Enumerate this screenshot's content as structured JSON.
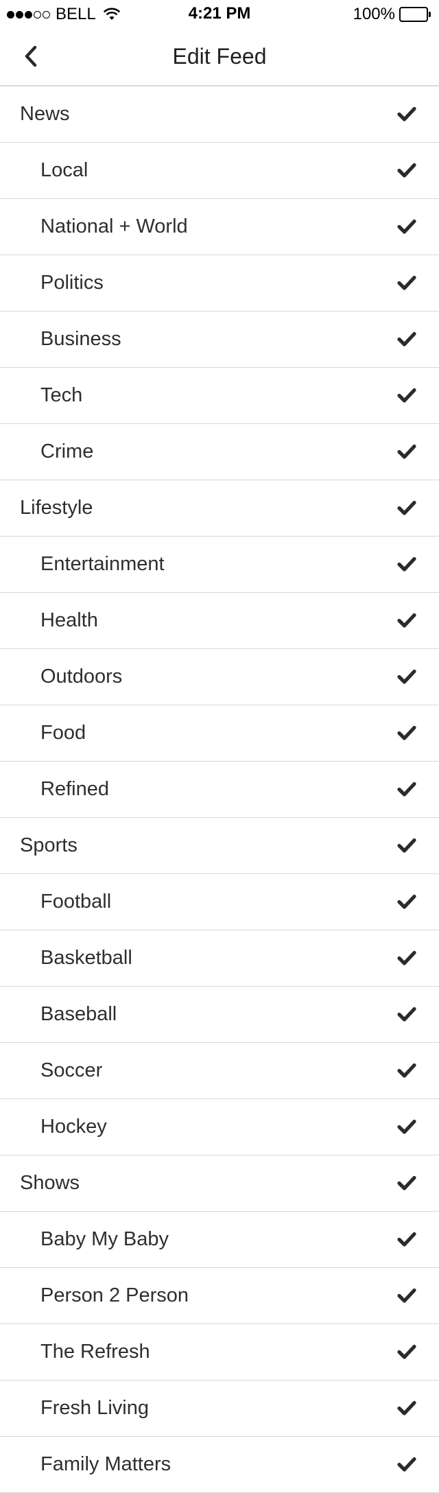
{
  "status_bar": {
    "carrier": "BELL",
    "time": "4:21 PM",
    "battery": "100%",
    "battery_level": 1.0,
    "signal_strength_of_5": 3,
    "icons": [
      "signal-dots-icon",
      "wifi-icon",
      "battery-icon"
    ]
  },
  "nav": {
    "title": "Edit Feed",
    "back_icon": "chevron-left-icon"
  },
  "check_color": "#2b2b2b",
  "feed": [
    {
      "label": "News",
      "level": "category",
      "checked": true
    },
    {
      "label": "Local",
      "level": "sub",
      "checked": true
    },
    {
      "label": "National + World",
      "level": "sub",
      "checked": true
    },
    {
      "label": "Politics",
      "level": "sub",
      "checked": true
    },
    {
      "label": "Business",
      "level": "sub",
      "checked": true
    },
    {
      "label": "Tech",
      "level": "sub",
      "checked": true
    },
    {
      "label": "Crime",
      "level": "sub",
      "checked": true
    },
    {
      "label": "Lifestyle",
      "level": "category",
      "checked": true
    },
    {
      "label": "Entertainment",
      "level": "sub",
      "checked": true
    },
    {
      "label": "Health",
      "level": "sub",
      "checked": true
    },
    {
      "label": "Outdoors",
      "level": "sub",
      "checked": true
    },
    {
      "label": "Food",
      "level": "sub",
      "checked": true
    },
    {
      "label": "Refined",
      "level": "sub",
      "checked": true
    },
    {
      "label": "Sports",
      "level": "category",
      "checked": true
    },
    {
      "label": "Football",
      "level": "sub",
      "checked": true
    },
    {
      "label": "Basketball",
      "level": "sub",
      "checked": true
    },
    {
      "label": "Baseball",
      "level": "sub",
      "checked": true
    },
    {
      "label": "Soccer",
      "level": "sub",
      "checked": true
    },
    {
      "label": "Hockey",
      "level": "sub",
      "checked": true
    },
    {
      "label": "Shows",
      "level": "category",
      "checked": true
    },
    {
      "label": "Baby My Baby",
      "level": "sub",
      "checked": true
    },
    {
      "label": "Person 2 Person",
      "level": "sub",
      "checked": true
    },
    {
      "label": "The Refresh",
      "level": "sub",
      "checked": true
    },
    {
      "label": "Fresh Living",
      "level": "sub",
      "checked": true
    },
    {
      "label": "Family Matters",
      "level": "sub",
      "checked": true
    }
  ]
}
